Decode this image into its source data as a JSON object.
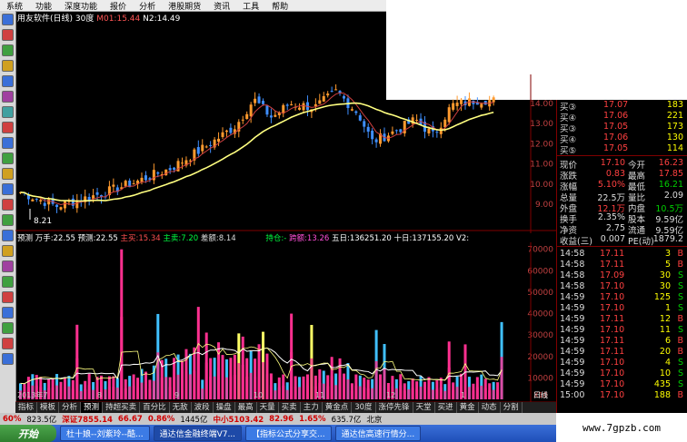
{
  "menu": [
    "系统",
    "功能",
    "深度功能",
    "报价",
    "分析",
    "港股期货",
    "资讯",
    "工具",
    "帮助"
  ],
  "chart_title": {
    "name": "用友软件(日线) 30度",
    "m1": "M01:15.44",
    "n2": "N2:14.49"
  },
  "low_label": "8.21",
  "price_axis": [
    "14.00",
    "13.00",
    "12.00",
    "11.00",
    "10.00",
    "9.00"
  ],
  "vol_axis": [
    "70000",
    "60000",
    "50000",
    "40000",
    "30000",
    "20000",
    "10000"
  ],
  "vol_unit": "X10",
  "vol_title": {
    "a": "预测  万手:22.55  预测:22.55",
    "b": "主买:15.34",
    "c": "主卖:7.20",
    "d": "差额:8.14",
    "e": "持仓:-",
    "f": "跨额:13.26",
    "g": "五日:136251.20  十日:137155.20  V2:"
  },
  "quote_top": [
    {
      "label": "买③",
      "price": "17.07",
      "vol": "183"
    },
    {
      "label": "买④",
      "price": "17.06",
      "vol": "221"
    },
    {
      "label": "买③",
      "price": "17.05",
      "vol": "173"
    },
    {
      "label": "买④",
      "price": "17.06",
      "vol": "130"
    },
    {
      "label": "买⑤",
      "price": "17.05",
      "vol": "114"
    }
  ],
  "stats": [
    {
      "l1": "现价",
      "v1": "17.10",
      "l2": "今开",
      "v2": "16.23"
    },
    {
      "l1": "涨跌",
      "v1": "0.83",
      "l2": "最高",
      "v2": "17.85"
    },
    {
      "l1": "涨幅",
      "v1": "5.10%",
      "l2": "最低",
      "v2": "16.21"
    },
    {
      "l1": "总量",
      "v1": "22.5万",
      "l2": "量比",
      "v2": "2.09"
    },
    {
      "l1": "外盘",
      "v1": "12.1万",
      "l2": "内盘",
      "v2": "10.5万"
    },
    {
      "l1": "换手",
      "v1": "2.35%",
      "l2": "股本",
      "v2": "9.59亿"
    },
    {
      "l1": "净资",
      "v1": "2.75",
      "l2": "流通",
      "v2": "9.59亿"
    },
    {
      "l1": "收益(三)",
      "v1": "0.007",
      "l2": "PE(动)",
      "v2": "1879.2"
    }
  ],
  "ticks": [
    {
      "t": "14:58",
      "p": "17.11",
      "v": "3",
      "s": "B"
    },
    {
      "t": "14:58",
      "p": "17.11",
      "v": "5",
      "s": "B"
    },
    {
      "t": "14:58",
      "p": "17.09",
      "v": "30",
      "s": "S"
    },
    {
      "t": "14:58",
      "p": "17.10",
      "v": "30",
      "s": "S"
    },
    {
      "t": "14:59",
      "p": "17.10",
      "v": "125",
      "s": "S"
    },
    {
      "t": "14:59",
      "p": "17.10",
      "v": "1",
      "s": "S"
    },
    {
      "t": "14:59",
      "p": "17.11",
      "v": "12",
      "s": "B"
    },
    {
      "t": "14:59",
      "p": "17.10",
      "v": "11",
      "s": "S"
    },
    {
      "t": "14:59",
      "p": "17.11",
      "v": "6",
      "s": "B"
    },
    {
      "t": "14:59",
      "p": "17.11",
      "v": "20",
      "s": "B"
    },
    {
      "t": "14:59",
      "p": "17.10",
      "v": "4",
      "s": "S"
    },
    {
      "t": "14:59",
      "p": "17.10",
      "v": "10",
      "s": "S"
    },
    {
      "t": "14:59",
      "p": "17.10",
      "v": "435",
      "s": "S"
    },
    {
      "t": "15:00",
      "p": "17.10",
      "v": "188",
      "s": "B"
    }
  ],
  "tabs": [
    "指标",
    "模板",
    "分析",
    "预测",
    "持超买卖",
    "百分比",
    "无敌",
    "波段",
    "操盘",
    "最高",
    "天量",
    "买卖",
    "主力",
    "黄金点",
    "30度",
    "涨停先锋",
    "天堂",
    "买进",
    "黄金",
    "动态",
    "分割"
  ],
  "date_labels": [
    "2013年7",
    "8",
    "9",
    "10",
    "11",
    "12",
    "1"
  ],
  "period_label": "日线",
  "status": {
    "pct": "60%",
    "v1": "823.5亿",
    "idx": "深证7855.14",
    "chg": "66.67",
    "pct2": "0.86%",
    "amt": "1445亿",
    "mid": "中小5103.42",
    "chg2": "82.96",
    "pct3": "1.65%",
    "amt2": "635.7亿",
    "region": "北京"
  },
  "watermark": "www.7gpzb.com",
  "taskbar": {
    "start": "开始",
    "items": [
      "杜十娘--刘紫玲--酷...",
      "通达信金融终端V7...",
      "【指标公式分享交...",
      "通达信高速行情分..."
    ]
  },
  "colors": {
    "up": "#ff4040",
    "down": "#00d000",
    "white": "#ffffff",
    "yellow": "#ffff00",
    "candle_up": "#ff9a2e",
    "candle_down": "#3f8fff"
  }
}
